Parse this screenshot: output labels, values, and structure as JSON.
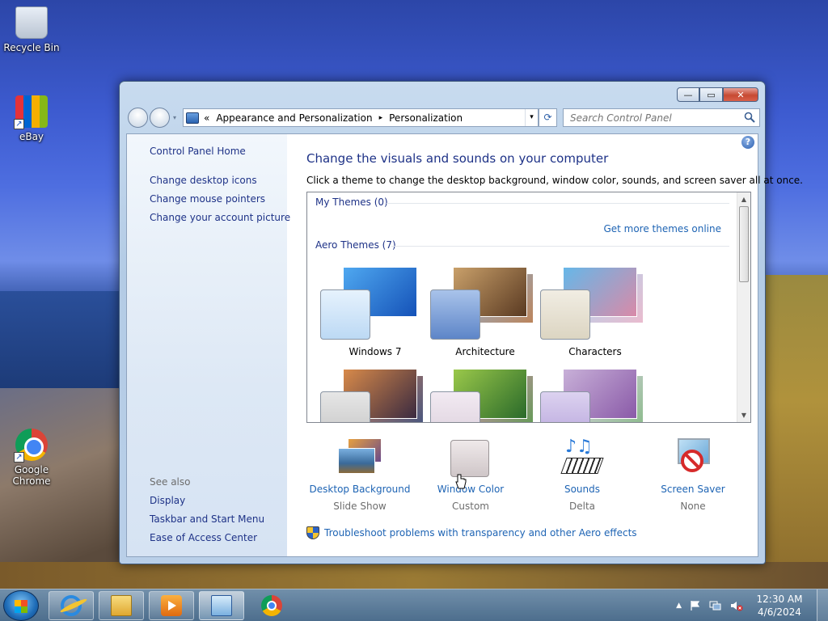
{
  "desktop": {
    "icons": [
      {
        "label": "Recycle Bin"
      },
      {
        "label": "eBay"
      },
      {
        "label": "Google Chrome"
      }
    ]
  },
  "window": {
    "caption": {
      "minimize": "—",
      "maximize": "▭",
      "close": "✕"
    },
    "address": {
      "chevrons": "«",
      "crumbs": [
        "Appearance and Personalization",
        "Personalization"
      ],
      "separator": "▸",
      "dropdown": "▾"
    },
    "refresh": "⟳",
    "search": {
      "placeholder": "Search Control Panel"
    },
    "sidebar": {
      "home": "Control Panel Home",
      "links": [
        "Change desktop icons",
        "Change mouse pointers",
        "Change your account picture"
      ],
      "see_also_heading": "See also",
      "see_also": [
        "Display",
        "Taskbar and Start Menu",
        "Ease of Access Center"
      ]
    },
    "main": {
      "help": "?",
      "title": "Change the visuals and sounds on your computer",
      "subtitle": "Click a theme to change the desktop background, window color, sounds, and screen saver all at once.",
      "my_themes": "My Themes (0)",
      "get_more": "Get more themes online",
      "aero_themes": "Aero Themes (7)",
      "themes": [
        {
          "name": "Windows 7",
          "bg": "#2a6fd8",
          "swatch": "#cfe4f8"
        },
        {
          "name": "Architecture",
          "bg": "#8a6a4a",
          "swatch": "#7b9fd6"
        },
        {
          "name": "Characters",
          "bg": "#7ab0d6",
          "swatch": "#e7e1d2"
        },
        {
          "name": "",
          "bg": "#6a4a3a",
          "swatch": "#d8d8d8"
        },
        {
          "name": "",
          "bg": "#6aa03a",
          "swatch": "#e8e0e8"
        },
        {
          "name": "",
          "bg": "#b8a0c8",
          "swatch": "#c6b8e0"
        }
      ],
      "bottom": [
        {
          "link": "Desktop Background",
          "sub": "Slide Show"
        },
        {
          "link": "Window Color",
          "sub": "Custom"
        },
        {
          "link": "Sounds",
          "sub": "Delta"
        },
        {
          "link": "Screen Saver",
          "sub": "None"
        }
      ],
      "troubleshoot": "Troubleshoot problems with transparency and other Aero effects"
    }
  },
  "taskbar": {
    "tray": {
      "arrow": "▲",
      "time": "12:30 AM",
      "date": "4/6/2024"
    }
  }
}
